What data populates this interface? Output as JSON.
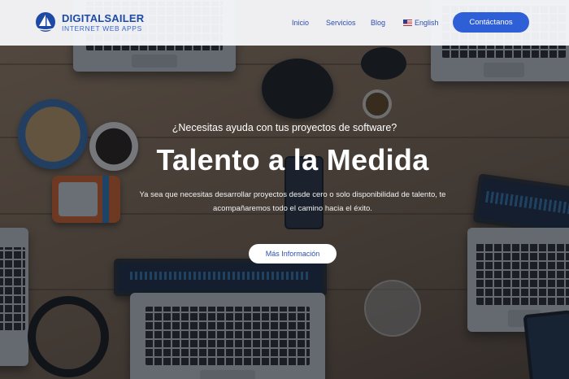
{
  "header": {
    "logo": {
      "name": "DIGITALSAILER",
      "tagline": "INTERNET WEB APPS"
    },
    "nav": {
      "inicio": "Inicio",
      "servicios": "Servicios",
      "blog": "Blog",
      "language": "English",
      "language_flag_icon": "us-flag-icon"
    },
    "contact_button": "Contáctanos"
  },
  "hero": {
    "subtitle": "¿Necesitas ayuda con tus proyectos de software?",
    "headline": "Talento a la Medida",
    "description": "Ya sea que necesitas desarrollar proyectos desde cero o solo disponibilidad de talento, te acompañaremos todo el camino hacia el éxito.",
    "more_button": "Más Información"
  },
  "colors": {
    "brand_blue": "#2f5fd6",
    "logo_blue": "#1e4aa6",
    "header_bg": "#f8f9fb",
    "hero_text": "#ffffff"
  }
}
